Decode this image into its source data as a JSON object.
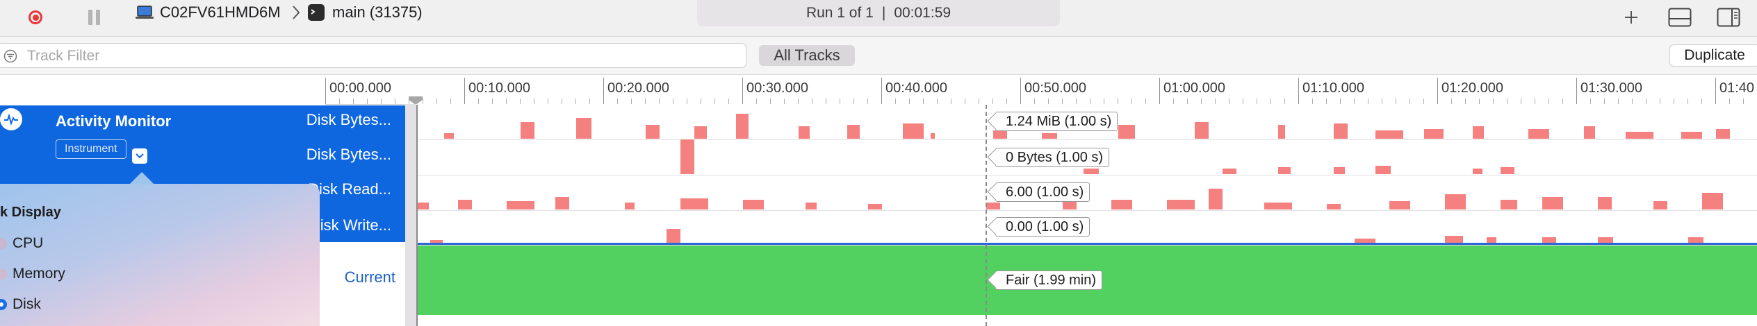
{
  "toolbar": {
    "record_icon": "record-icon",
    "pause_icon": "pause-icon",
    "device": "C02FV61HMD6M",
    "target": "main (31375)",
    "run": "Run 1 of 1",
    "separator": "|",
    "elapsed": "00:01:59"
  },
  "filter": {
    "placeholder": "Track Filter",
    "scope": "All Tracks",
    "duplicate": "Duplicate"
  },
  "ruler": {
    "labels": [
      "00:00.000",
      "00:10.000",
      "00:20.000",
      "00:30.000",
      "00:40.000",
      "00:50.000",
      "01:00.000",
      "01:10.000",
      "01:20.000",
      "01:30.000",
      "01:40"
    ]
  },
  "instrument": {
    "name": "Activity Monitor",
    "badge": "Instrument",
    "tracks": [
      "Disk Bytes...",
      "Disk Bytes...",
      "Disk Read...",
      "Disk Write..."
    ],
    "current_label": "Current"
  },
  "popover": {
    "title": "k Display",
    "options": [
      "CPU",
      "Memory",
      "Disk"
    ],
    "selected": "Disk"
  },
  "inspection": {
    "values": [
      "1.24 MiB (1.00 s)",
      "0 Bytes (1.00 s)",
      "6.00 (1.00 s)",
      "0.00 (1.00 s)"
    ],
    "current_value": "Fair (1.99 min)"
  },
  "colors": {
    "selection_blue": "#0f67e0",
    "bar_red": "#f4817f",
    "thermal_green": "#52d060",
    "record_red": "#e8383b"
  }
}
